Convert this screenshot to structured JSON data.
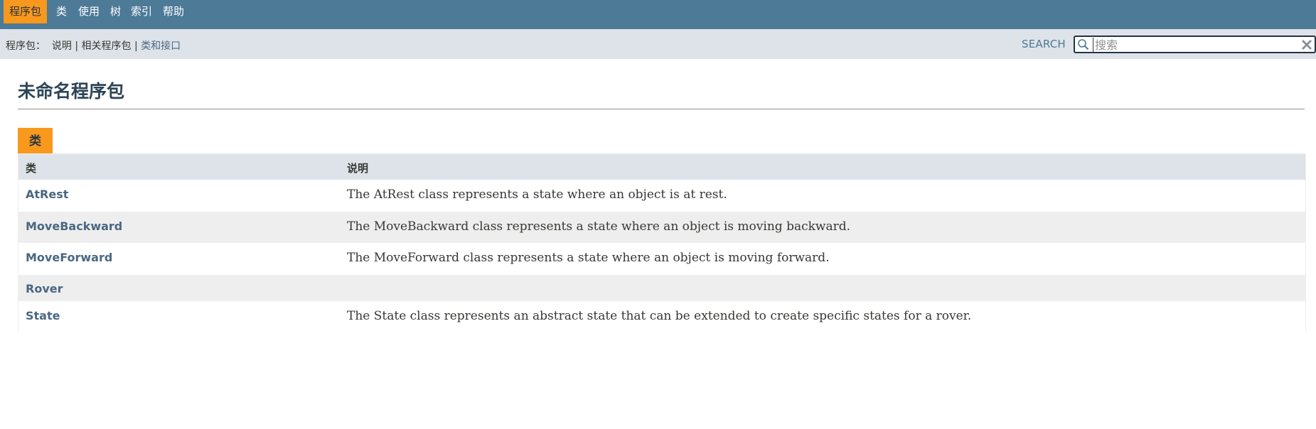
{
  "top_nav": {
    "items": [
      "程序包",
      "类",
      "使用",
      "树",
      "索引",
      "帮助"
    ],
    "active_index": 0
  },
  "sub_nav": {
    "prefix": "程序包：",
    "links": [
      "说明",
      "相关程序包",
      "类和接口"
    ],
    "separator": "|"
  },
  "search": {
    "label": "SEARCH",
    "placeholder": "搜索",
    "value": ""
  },
  "page": {
    "title": "未命名程序包"
  },
  "class_summary": {
    "caption": "类",
    "headers": {
      "class": "类",
      "description": "说明"
    },
    "rows": [
      {
        "name": "AtRest",
        "description": "The AtRest class represents a state where an object is at rest."
      },
      {
        "name": "MoveBackward",
        "description": "The MoveBackward class represents a state where an object is moving backward."
      },
      {
        "name": "MoveForward",
        "description": "The MoveForward class represents a state where an object is moving forward."
      },
      {
        "name": "Rover",
        "description": ""
      },
      {
        "name": "State",
        "description": "The State class represents an abstract state that can be extended to create specific states for a rover."
      }
    ]
  },
  "colors": {
    "nav_bar": "#4d7a97",
    "active_tab": "#f8981d",
    "sub_nav": "#dee3e9",
    "link": "#4a6782",
    "title": "#2c4557",
    "stripe": "#eeeeee"
  },
  "icons": {
    "search": "magnifier-icon",
    "reset": "close-x-icon"
  }
}
